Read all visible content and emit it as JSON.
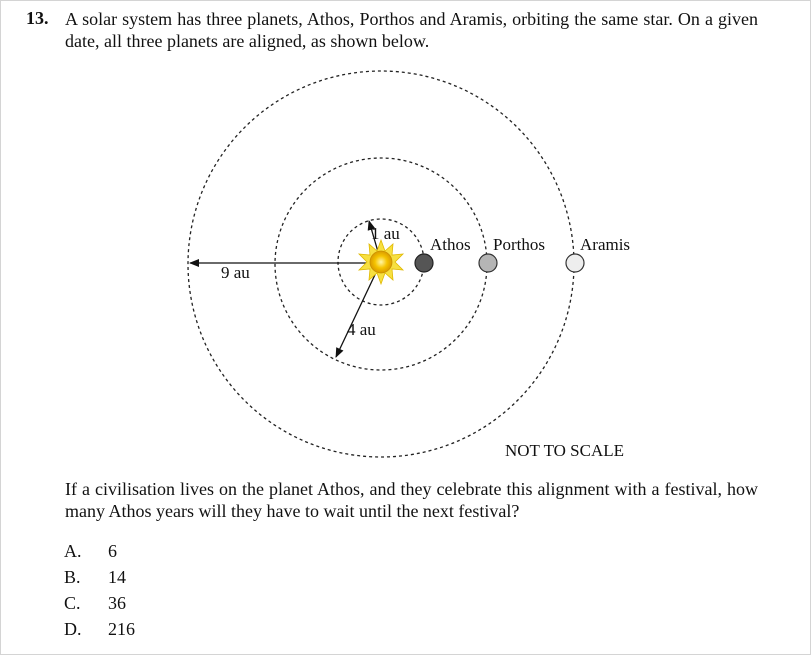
{
  "question": {
    "number": "13.",
    "intro": "A solar system has three planets, Athos, Porthos and Aramis, orbiting the same star. On a given date, all three planets are aligned, as shown below.",
    "prompt": "If a civilisation lives on the planet Athos, and they celebrate this alignment with a festival, how many Athos years will they have to wait until the next festival?"
  },
  "diagram": {
    "labels": {
      "radius_inner": "1 au",
      "radius_middle": "4 au",
      "radius_outer": "9 au",
      "planet_1": "Athos",
      "planet_2": "Porthos",
      "planet_3": "Aramis",
      "note": "NOT TO SCALE"
    },
    "colors": {
      "star": "#f5c400",
      "star_rays": "#f7e040",
      "athos": "#555555",
      "porthos": "#b5b5b5",
      "aramis": "#eeeeee"
    }
  },
  "options": [
    {
      "letter": "A.",
      "value": "6"
    },
    {
      "letter": "B.",
      "value": "14"
    },
    {
      "letter": "C.",
      "value": "36"
    },
    {
      "letter": "D.",
      "value": "216"
    }
  ]
}
